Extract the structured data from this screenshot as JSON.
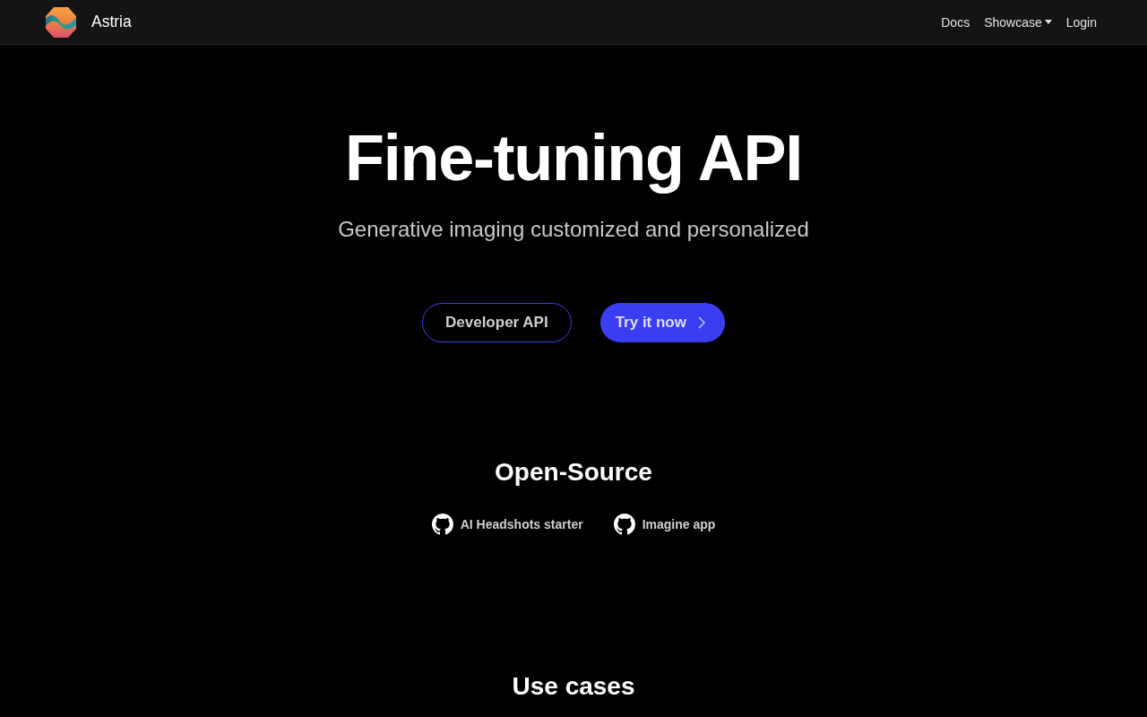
{
  "navbar": {
    "brand": "Astria",
    "links": [
      {
        "label": "Docs",
        "kind": "link"
      },
      {
        "label": "Showcase",
        "kind": "dropdown"
      },
      {
        "label": "Login",
        "kind": "link"
      }
    ]
  },
  "hero": {
    "title": "Fine-tuning API",
    "subtitle": "Generative imaging customized and personalized",
    "buttons": [
      {
        "label": "Developer API",
        "kind": "outline"
      },
      {
        "label": "Try it now",
        "kind": "primary"
      }
    ]
  },
  "open_source": {
    "heading": "Open-Source",
    "links": [
      "AI Headshots starter",
      "Imagine app"
    ]
  },
  "use_cases": {
    "heading": "Use cases"
  }
}
